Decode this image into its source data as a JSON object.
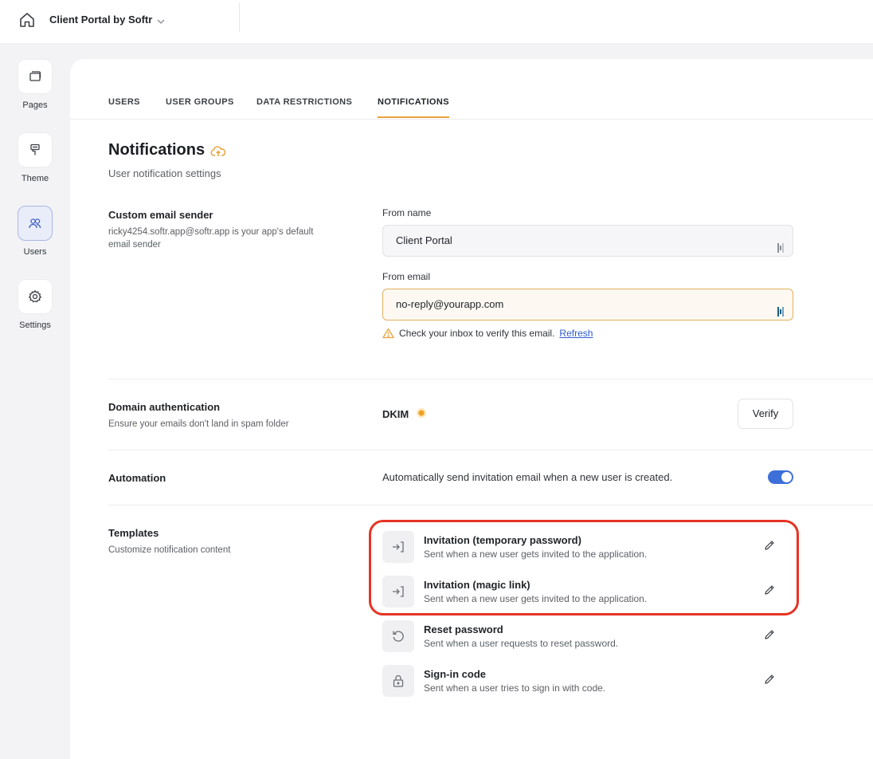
{
  "topbar": {
    "app_name": "Client Portal by Softr"
  },
  "rail": {
    "items": [
      {
        "label": "Pages",
        "icon": "pages-icon"
      },
      {
        "label": "Theme",
        "icon": "paint-roller-icon"
      },
      {
        "label": "Users",
        "icon": "users-icon",
        "active": true
      },
      {
        "label": "Settings",
        "icon": "gear-icon"
      }
    ]
  },
  "tabs": [
    "USERS",
    "USER GROUPS",
    "DATA RESTRICTIONS",
    "NOTIFICATIONS"
  ],
  "active_tab": "NOTIFICATIONS",
  "page": {
    "title": "Notifications",
    "subtitle": "User notification settings"
  },
  "custom_sender": {
    "title": "Custom email sender",
    "desc": "ricky4254.softr.app@softr.app is your app's default email sender",
    "from_name_label": "From name",
    "from_name_value": "Client Portal",
    "from_email_label": "From email",
    "from_email_value": "no-reply@yourapp.com",
    "hint_text": "Check your inbox to verify this email.",
    "hint_link": "Refresh"
  },
  "domain_auth": {
    "title": "Domain authentication",
    "desc": "Ensure your emails don't land in spam folder",
    "dkim_label": "DKIM",
    "verify_label": "Verify"
  },
  "automation": {
    "title": "Automation",
    "text": "Automatically send invitation email when a new user is created.",
    "enabled": true
  },
  "templates": {
    "title": "Templates",
    "desc": "Customize notification content",
    "items": [
      {
        "title": "Invitation (temporary password)",
        "desc": "Sent when a new user gets invited to the application.",
        "icon": "login-icon"
      },
      {
        "title": "Invitation (magic link)",
        "desc": "Sent when a new user gets invited to the application.",
        "icon": "login-icon"
      },
      {
        "title": "Reset password",
        "desc": "Sent when a user requests to reset password.",
        "icon": "reset-icon"
      },
      {
        "title": "Sign-in code",
        "desc": "Sent when a user tries to sign in with code.",
        "icon": "lock-icon"
      }
    ]
  },
  "colors": {
    "accent_orange": "#e8a23b",
    "toggle_blue": "#3d6fd8",
    "highlight_red": "#e53424",
    "link_blue": "#2d5bd0"
  }
}
